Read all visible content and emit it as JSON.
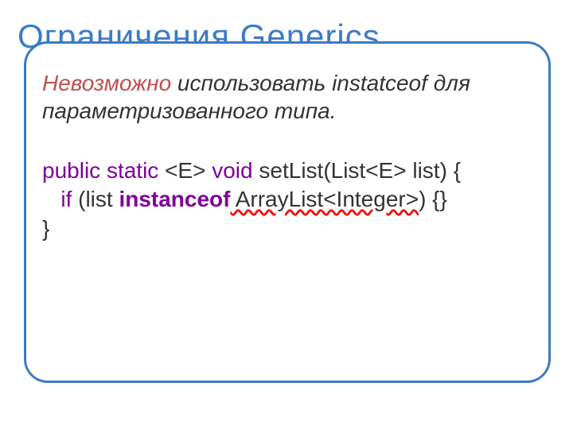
{
  "title": "Ограничения Generics",
  "description": {
    "emph": "Невозможно",
    "rest": " использовать instatceof для параметризованного типа."
  },
  "code": {
    "kw_public_static": "public static",
    "genericE": " <E> ",
    "kw_void": "void",
    "sig_rest": " setList(List<E> list) {",
    "kw_if": "if",
    "if_open": " (list ",
    "kw_instanceof": "instanceof",
    "err_part": " ArrayList<Integer>",
    "if_close": ") {}",
    "close": "}"
  }
}
